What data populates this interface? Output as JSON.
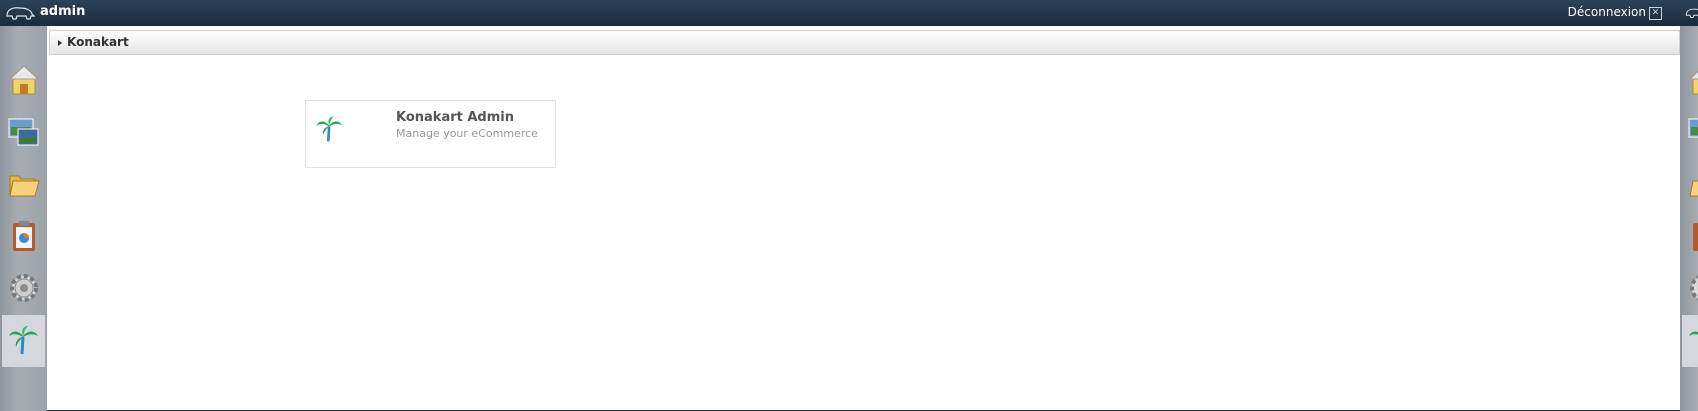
{
  "topbar": {
    "user": "admin",
    "logout_label": "Déconnexion",
    "logout_icon": "close-box-icon",
    "logo_icon": "elephant-logo-icon"
  },
  "dock": {
    "items": [
      {
        "name": "home",
        "icon": "house-icon",
        "active": false
      },
      {
        "name": "sites",
        "icon": "sites-icon",
        "active": false
      },
      {
        "name": "documents",
        "icon": "folder-icon",
        "active": false
      },
      {
        "name": "reports",
        "icon": "clipboard-chart-icon",
        "active": false
      },
      {
        "name": "settings",
        "icon": "gear-icon",
        "active": false
      },
      {
        "name": "konakart",
        "icon": "palm-tree-icon",
        "active": true
      }
    ]
  },
  "breadcrumb": {
    "label": "Konakart"
  },
  "tile": {
    "title": "Konakart Admin",
    "subtitle": "Manage your eCommerce",
    "icon": "palm-tree-icon"
  }
}
